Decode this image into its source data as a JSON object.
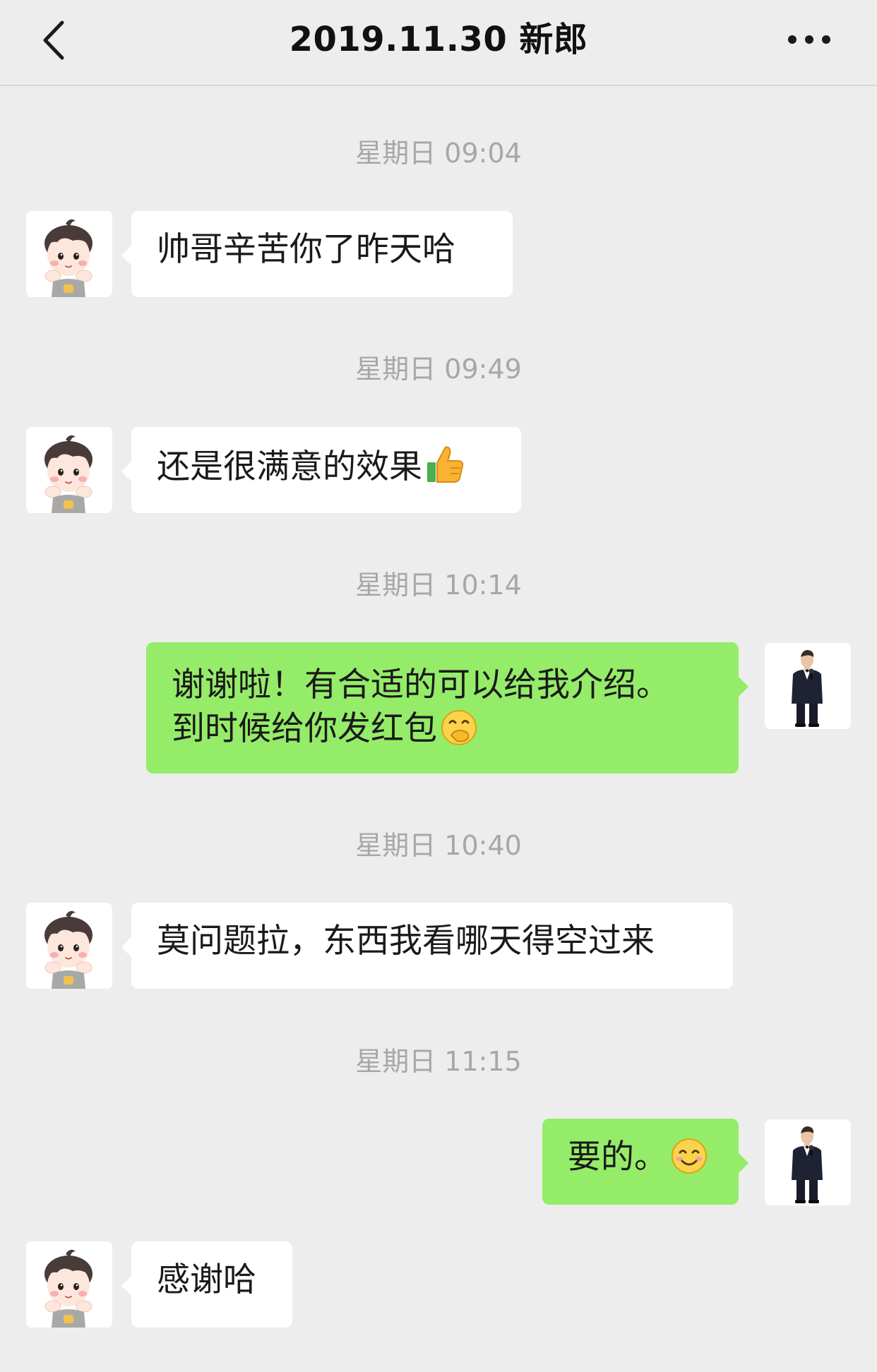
{
  "header": {
    "title": "2019.11.30 新郎",
    "back_icon": "chevron-left-icon",
    "more_icon": "more-horizontal-icon"
  },
  "theme": {
    "background": "#ededed",
    "incoming_bubble": "#ffffff",
    "outgoing_bubble": "#95ec69",
    "timestamp_color": "#a7a7a7"
  },
  "messages": [
    {
      "time": "星期日 09:04",
      "sender": "contact",
      "text": "帅哥辛苦你了昨天哈"
    },
    {
      "time": "星期日 09:49",
      "sender": "contact",
      "text": "还是很满意的效果",
      "emoji": "thumbs-up-icon"
    },
    {
      "time": "星期日 10:14",
      "sender": "me",
      "text_line1": "谢谢啦！有合适的可以给我介绍。",
      "text_line2": "到时候给你发红包",
      "emoji": "face-hand-over-mouth-icon"
    },
    {
      "time": "星期日 10:40",
      "sender": "contact",
      "text": "莫问题拉，东西我看哪天得空过来"
    },
    {
      "time": "星期日 11:15",
      "sender": "me",
      "text": "要的。",
      "emoji": "smiling-face-icon"
    },
    {
      "sender": "contact",
      "text": "感谢哈"
    }
  ]
}
